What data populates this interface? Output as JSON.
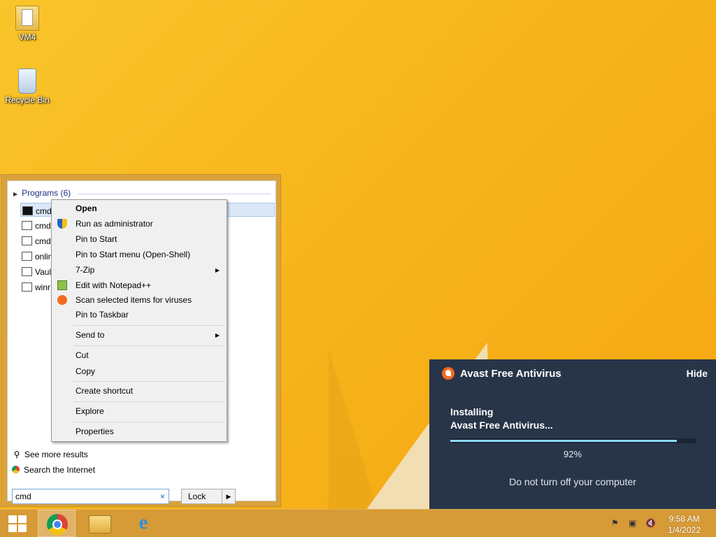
{
  "desktop": {
    "icons": [
      {
        "label": "VM4",
        "icon": "folder-icon"
      },
      {
        "label": "Recycle Bin",
        "icon": "recycle-bin-icon"
      }
    ]
  },
  "start_menu": {
    "programs_header": "Programs (6)",
    "programs": [
      {
        "label": "cmd",
        "icon": "console-icon"
      },
      {
        "label": "cmd",
        "icon": "window-icon"
      },
      {
        "label": "cmd",
        "icon": "script-icon"
      },
      {
        "label": "onlin",
        "icon": "gear-window-icon"
      },
      {
        "label": "Vaul",
        "icon": "window-icon"
      },
      {
        "label": "winr",
        "icon": "gear-window-icon"
      }
    ],
    "see_more": "See more results",
    "search_internet": "Search the Internet",
    "search_value": "cmd",
    "clear_glyph": "×",
    "lock_label": "Lock",
    "lock_arrow": "▶"
  },
  "context_menu": {
    "items": {
      "open": "Open",
      "run_admin": "Run as administrator",
      "pin_start": "Pin to Start",
      "pin_start_menu": "Pin to Start menu (Open-Shell)",
      "seven_zip": "7-Zip",
      "edit_npp": "Edit with Notepad++",
      "scan": "Scan selected items for viruses",
      "pin_taskbar": "Pin to Taskbar",
      "send_to": "Send to",
      "cut": "Cut",
      "copy": "Copy",
      "create_shortcut": "Create shortcut",
      "explore": "Explore",
      "properties": "Properties"
    },
    "submenu_arrow": "▶"
  },
  "avast": {
    "title": "Avast Free Antivirus",
    "hide": "Hide",
    "status_line1": "Installing",
    "status_line2": "Avast Free Antivirus...",
    "progress_fraction": 0.92,
    "progress_text": "92%",
    "note": "Do not turn off your computer",
    "brand_color": "#f36b21",
    "panel_color": "#283548"
  },
  "taskbar": {
    "apps": [
      "windows-start-icon",
      "chrome-icon",
      "file-explorer-icon",
      "internet-explorer-icon"
    ],
    "tray": [
      "action-center-flag-icon",
      "network-icon",
      "volume-muted-icon"
    ],
    "time": "9:58 AM",
    "date": "1/4/2022"
  }
}
